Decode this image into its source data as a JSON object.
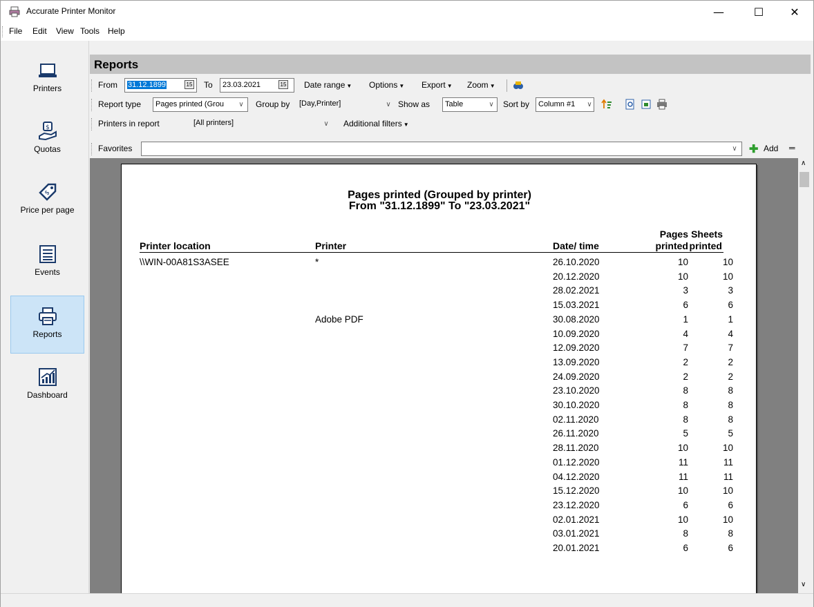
{
  "window": {
    "title": "Accurate Printer Monitor"
  },
  "menu": [
    "File",
    "Edit",
    "View",
    "Tools",
    "Help"
  ],
  "sidebar": {
    "items": [
      {
        "label": "Printers",
        "icon": "laptop-icon"
      },
      {
        "label": "Quotas",
        "icon": "quota-icon"
      },
      {
        "label": "Price per page",
        "icon": "price-tag-icon"
      },
      {
        "label": "Events",
        "icon": "list-icon"
      },
      {
        "label": "Reports",
        "icon": "printer-icon",
        "active": true
      },
      {
        "label": "Dashboard",
        "icon": "chart-icon"
      }
    ]
  },
  "header": {
    "title": "Reports"
  },
  "toolbar": {
    "from_label": "From",
    "from_value": "31.12.1899",
    "to_label": "To",
    "to_value": "23.03.2021",
    "date_range": "Date range",
    "options": "Options",
    "export": "Export",
    "zoom": "Zoom",
    "report_type_label": "Report type",
    "report_type_value": "Pages printed (Grou",
    "group_by_label": "Group by",
    "group_by_value": "[Day,Printer]",
    "show_as_label": "Show as",
    "show_as_value": "Table",
    "sort_by_label": "Sort by",
    "sort_by_value": "Column #1",
    "printers_label": "Printers in report",
    "printers_value": "[All printers]",
    "additional_filters": "Additional filters",
    "favorites_label": "Favorites",
    "favorites_value": "",
    "add_label": "Add"
  },
  "report": {
    "title_line1": "Pages printed (Grouped by printer)",
    "title_line2": "From \"31.12.1899\" To \"23.03.2021\"",
    "columns": {
      "location": "Printer location",
      "printer": "Printer",
      "datetime": "Date/ time",
      "pages_top": "Pages",
      "pages_bottom": "printed",
      "sheets_top": "Sheets",
      "sheets_bottom": "printed"
    },
    "rows": [
      {
        "location": "\\\\WIN-00A81S3ASEE",
        "printer": "*",
        "date": "26.10.2020",
        "pages": "10",
        "sheets": "10"
      },
      {
        "location": "",
        "printer": "",
        "date": "20.12.2020",
        "pages": "10",
        "sheets": "10"
      },
      {
        "location": "",
        "printer": "",
        "date": "28.02.2021",
        "pages": "3",
        "sheets": "3"
      },
      {
        "location": "",
        "printer": "",
        "date": "15.03.2021",
        "pages": "6",
        "sheets": "6"
      },
      {
        "location": "",
        "printer": "Adobe PDF",
        "date": "30.08.2020",
        "pages": "1",
        "sheets": "1"
      },
      {
        "location": "",
        "printer": "",
        "date": "10.09.2020",
        "pages": "4",
        "sheets": "4"
      },
      {
        "location": "",
        "printer": "",
        "date": "12.09.2020",
        "pages": "7",
        "sheets": "7"
      },
      {
        "location": "",
        "printer": "",
        "date": "13.09.2020",
        "pages": "2",
        "sheets": "2"
      },
      {
        "location": "",
        "printer": "",
        "date": "24.09.2020",
        "pages": "2",
        "sheets": "2"
      },
      {
        "location": "",
        "printer": "",
        "date": "23.10.2020",
        "pages": "8",
        "sheets": "8"
      },
      {
        "location": "",
        "printer": "",
        "date": "30.10.2020",
        "pages": "8",
        "sheets": "8"
      },
      {
        "location": "",
        "printer": "",
        "date": "02.11.2020",
        "pages": "8",
        "sheets": "8"
      },
      {
        "location": "",
        "printer": "",
        "date": "26.11.2020",
        "pages": "5",
        "sheets": "5"
      },
      {
        "location": "",
        "printer": "",
        "date": "28.11.2020",
        "pages": "10",
        "sheets": "10"
      },
      {
        "location": "",
        "printer": "",
        "date": "01.12.2020",
        "pages": "11",
        "sheets": "11"
      },
      {
        "location": "",
        "printer": "",
        "date": "04.12.2020",
        "pages": "11",
        "sheets": "11"
      },
      {
        "location": "",
        "printer": "",
        "date": "15.12.2020",
        "pages": "10",
        "sheets": "10"
      },
      {
        "location": "",
        "printer": "",
        "date": "23.12.2020",
        "pages": "6",
        "sheets": "6"
      },
      {
        "location": "",
        "printer": "",
        "date": "02.01.2021",
        "pages": "10",
        "sheets": "10"
      },
      {
        "location": "",
        "printer": "",
        "date": "03.01.2021",
        "pages": "8",
        "sheets": "8"
      },
      {
        "location": "",
        "printer": "",
        "date": "20.01.2021",
        "pages": "6",
        "sheets": "6"
      }
    ]
  },
  "colors": {
    "accent": "#0078d7",
    "sidebar_active": "#cce4f7",
    "header_bg": "#c3c3c3",
    "viewer_bg": "#808080"
  }
}
